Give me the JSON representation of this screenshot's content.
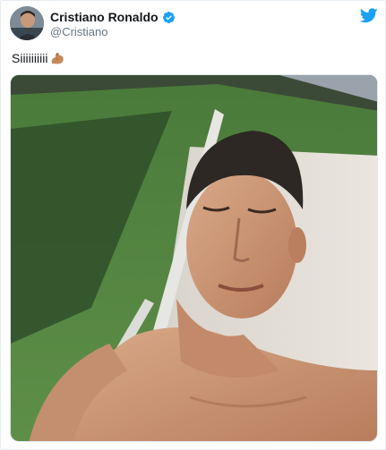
{
  "tweet": {
    "display_name": "Cristiano Ronaldo",
    "handle": "@Cristiano",
    "verified": true,
    "text": "Siiiiiiiiii",
    "emoji": "flexed-biceps-icon"
  },
  "icons": {
    "avatar": "profile-photo",
    "verified": "verified-badge-icon",
    "logo": "twitter-bird-icon"
  },
  "colors": {
    "verified_blue": "#1da1f2",
    "twitter_blue": "#1da1f2",
    "handle_gray": "#657786"
  }
}
